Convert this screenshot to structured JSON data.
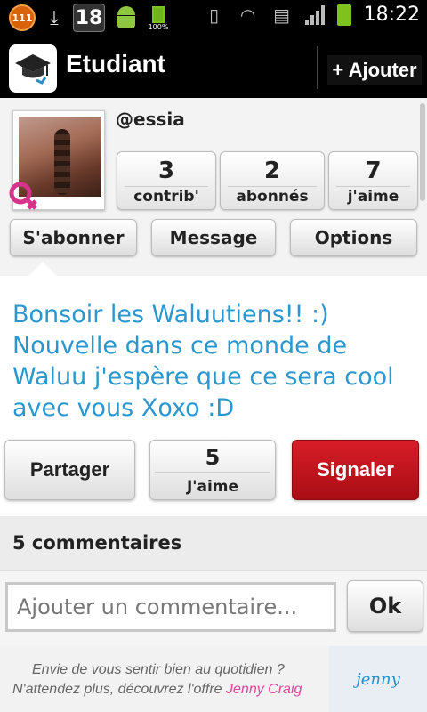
{
  "status_bar": {
    "badge": "111",
    "calendar_day": "18",
    "battery_pct": "100%",
    "time": "18:22"
  },
  "app_bar": {
    "title": "Etudiant",
    "add_button": "+ Ajouter"
  },
  "profile": {
    "username": "@essia",
    "stats": [
      {
        "value": "3",
        "label": "contrib'"
      },
      {
        "value": "2",
        "label": "abonnés"
      },
      {
        "value": "7",
        "label": "j'aime"
      }
    ],
    "buttons": {
      "subscribe": "S'abonner",
      "message": "Message",
      "options": "Options"
    }
  },
  "post": {
    "text": "Bonsoir les Waluutiens!! :) Nouvelle dans ce monde de Waluu j'espère que ce sera cool avec vous Xoxo :D",
    "share_label": "Partager",
    "like_count": "5",
    "like_label": "J'aime",
    "report_label": "Signaler"
  },
  "comments": {
    "header": "5 commentaires",
    "input_placeholder": "Ajouter un commentaire...",
    "submit": "Ok"
  },
  "ad": {
    "line1": "Envie de vous sentir bien au quotidien ?",
    "line2_prefix": "N'attendez plus, découvrez l'offre ",
    "brand": "Jenny Craig",
    "logo_text": "jenny"
  },
  "colors": {
    "post_text": "#2a97cf",
    "report_button": "#c8151f",
    "app_bar": "#000000"
  }
}
